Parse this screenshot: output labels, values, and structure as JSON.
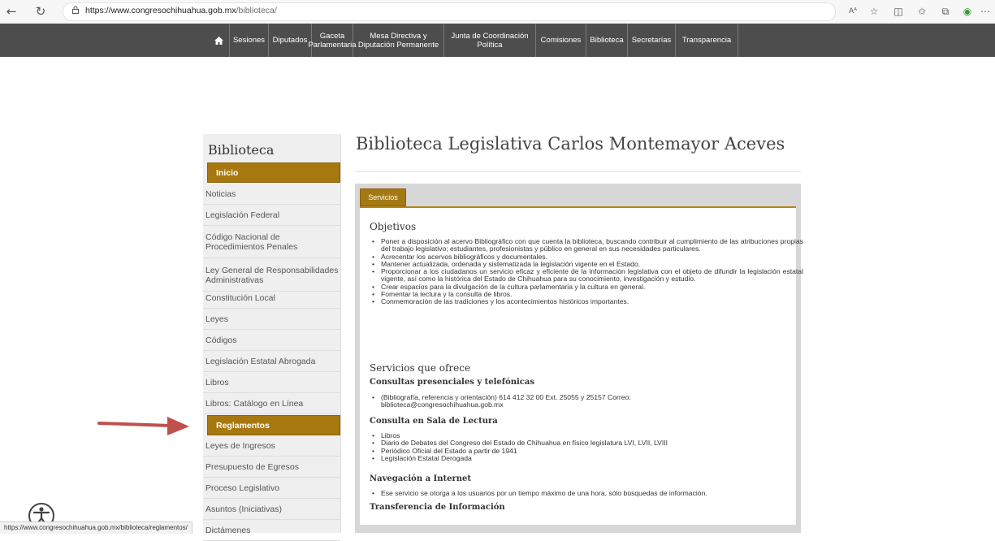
{
  "browser": {
    "url_domain": "https://www.congresochihuahua.gob.mx",
    "url_path": "/biblioteca/",
    "status_url": "https://www.congresochihuahua.gob.mx/biblioteca/reglamentos/",
    "read_aloud_label": "Aᴬ"
  },
  "topnav": {
    "items": [
      {
        "label": "Sesiones"
      },
      {
        "label": "Diputados"
      },
      {
        "label": "Gaceta Parlamentaria"
      },
      {
        "label": "Mesa Directiva y Diputación Permanente"
      },
      {
        "label": "Junta de Coordinación Política"
      },
      {
        "label": "Comisiones"
      },
      {
        "label": "Biblioteca"
      },
      {
        "label": "Secretarías"
      },
      {
        "label": "Transparencia"
      }
    ]
  },
  "sidebar": {
    "title": "Biblioteca",
    "items": [
      {
        "label": "Inicio"
      },
      {
        "label": "Noticias"
      },
      {
        "label": "Legislación Federal"
      },
      {
        "label": "Código Nacional de Procedimientos Penales"
      },
      {
        "label": "Ley General de Responsabilidades Administrativas"
      },
      {
        "label": "Constitución Local"
      },
      {
        "label": "Leyes"
      },
      {
        "label": "Códigos"
      },
      {
        "label": "Legislación Estatal Abrogada"
      },
      {
        "label": "Libros"
      },
      {
        "label": "Libros: Catálogo en Línea"
      },
      {
        "label": "Reglamentos"
      },
      {
        "label": "Leyes de Ingresos"
      },
      {
        "label": "Presupuesto de Egresos"
      },
      {
        "label": "Proceso Legislativo"
      },
      {
        "label": "Asuntos (Iniciativas)"
      },
      {
        "label": "Dictámenes"
      }
    ]
  },
  "main": {
    "title": "Biblioteca Legislativa Carlos Montemayor Aceves",
    "tab_label": "Servicios",
    "objetivos": {
      "heading": "Objetivos",
      "items": [
        "Poner a disposición al acervo Bibliográfico con que cuenta la biblioteca, buscando contribuir al cumplimiento de las atribuciones propias del trabajo legislativo; estudiantes, profesionistas y público en general en sus necesidades particulares.",
        "Acrecentar los acervos bibliográficos y documentales.",
        "Mantener actualizada, ordenada y sistematizada la legislación vigente en el Estado.",
        "Proporcionar a los ciudadanos un servicio eficaz y eficiente de la información legislativa con el objeto de difundir la legislación estatal vigente, así como la histórica del Estado de Chihuahua para su conocimiento, investigación y estudio.",
        "Crear espacios para la divulgación de la cultura parlamentaria y la cultura en general.",
        "Fomentar la lectura y la consulta de libros.",
        "Conmemoración de las tradiciones y los acontecimientos históricos importantes."
      ]
    },
    "servicios": {
      "heading": "Servicios que ofrece",
      "consultas_heading": "Consultas presenciales y telefónicas",
      "consultas_items": [
        "(Bibliografía, referencia y orientación) 614 412 32 00 Ext. 25055 y 25157 Correo: biblioteca@congresochihuahua.gob.mx"
      ],
      "sala_heading": "Consulta en Sala de Lectura",
      "sala_items": [
        "Libros",
        "Diario de Debates del Congreso del Estado de Chihuahua en físico legislatura LVI, LVII, LVIII",
        "Periódico Oficial del Estado a partir de 1941",
        "Legislación Estatal Derogada"
      ],
      "internet_heading": "Navegación a Internet",
      "internet_items": [
        "Ese servicio se otorga a los usuarios por un tiempo máximo de una hora, sólo búsquedas de información."
      ],
      "transferencia_heading": "Transferencia de Información"
    }
  }
}
